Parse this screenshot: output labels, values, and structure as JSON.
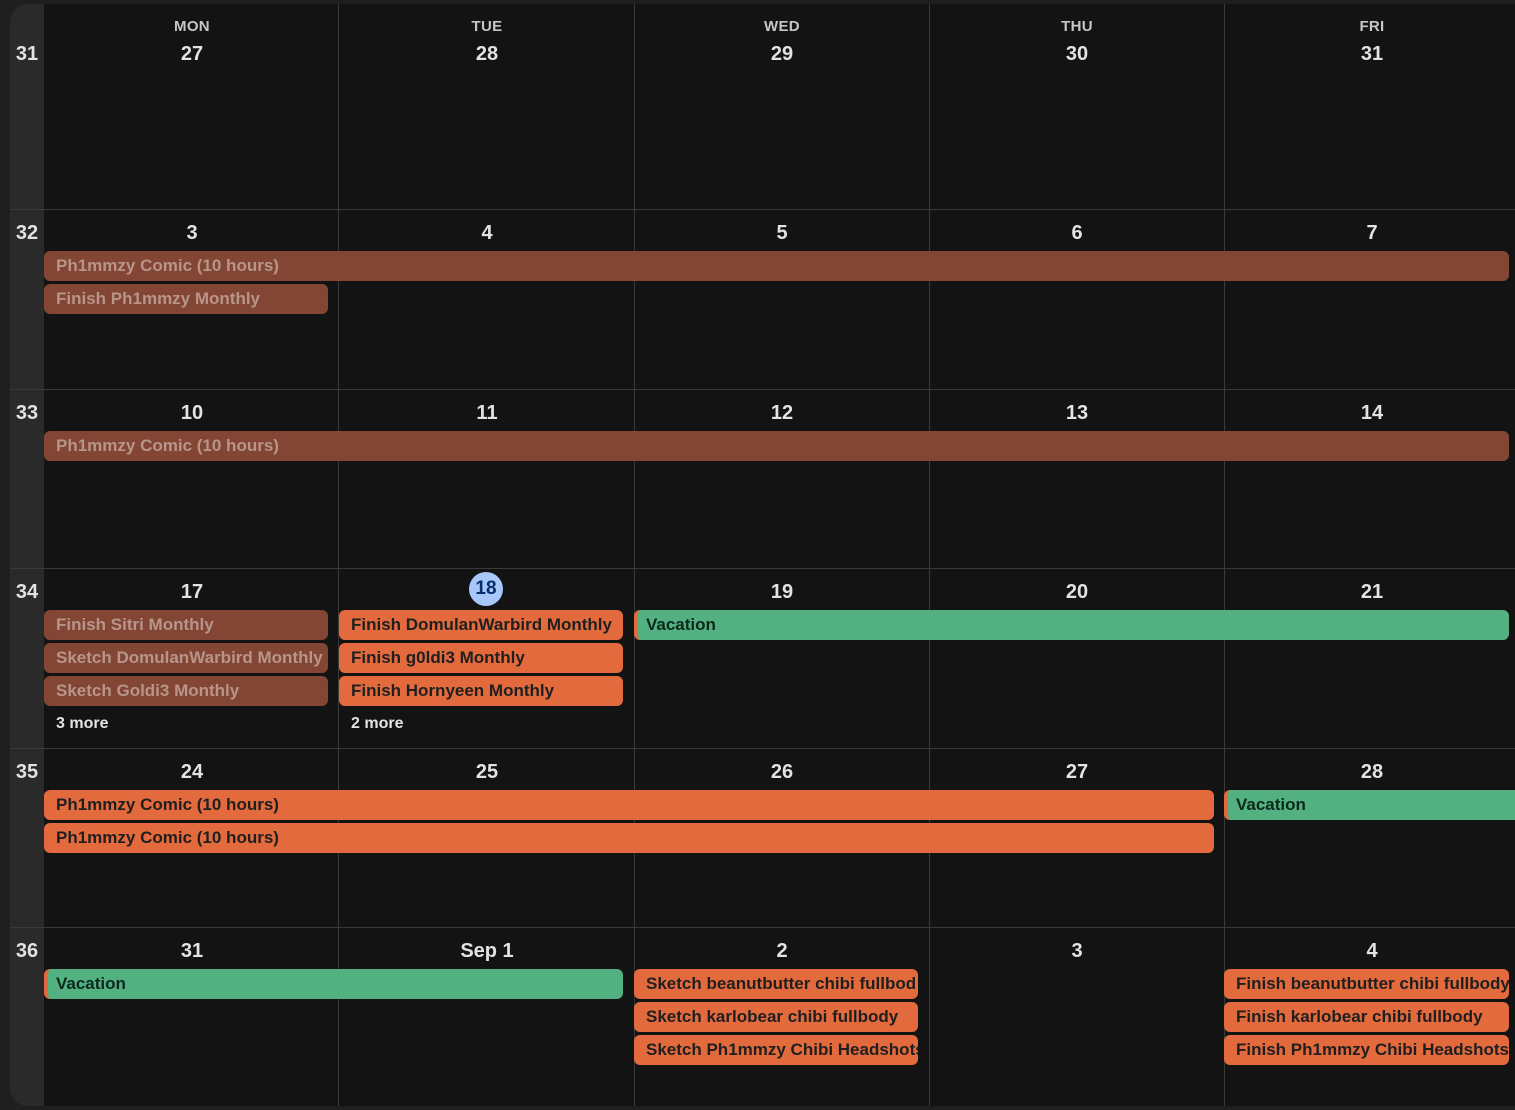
{
  "weekdays": [
    "MON",
    "TUE",
    "WED",
    "THU",
    "FRI"
  ],
  "weeks": [
    {
      "number": "31",
      "days": [
        "27",
        "28",
        "29",
        "30",
        "31"
      ]
    },
    {
      "number": "32",
      "days": [
        "3",
        "4",
        "5",
        "6",
        "7"
      ]
    },
    {
      "number": "33",
      "days": [
        "10",
        "11",
        "12",
        "13",
        "14"
      ]
    },
    {
      "number": "34",
      "days": [
        "17",
        "18",
        "19",
        "20",
        "21"
      ]
    },
    {
      "number": "35",
      "days": [
        "24",
        "25",
        "26",
        "27",
        "28"
      ]
    },
    {
      "number": "36",
      "days": [
        "31",
        "Sep 1",
        "2",
        "3",
        "4"
      ]
    }
  ],
  "today": "18",
  "events": {
    "w32_comic": "Ph1mmzy Comic (10 hours)",
    "w32_monthly": "Finish Ph1mmzy Monthly",
    "w33_comic": "Ph1mmzy Comic (10 hours)",
    "w34_sitri": "Finish Sitri Monthly",
    "w34_sketch_domulan": "Sketch DomulanWarbird Monthly",
    "w34_sketch_goldi": "Sketch Goldi3 Monthly",
    "w34_mon_more": "3 more",
    "w34_finish_domulan": "Finish DomulanWarbird Monthly",
    "w34_finish_g0ldi3": "Finish g0ldi3 Monthly",
    "w34_finish_hornyeen": "Finish Hornyeen Monthly",
    "w34_tue_more": "2 more",
    "w34_vacation": "Vacation",
    "w35_comic_1": "Ph1mmzy Comic (10 hours)",
    "w35_comic_2": "Ph1mmzy Comic (10 hours)",
    "w35_vacation": "Vacation",
    "w36_vacation": "Vacation",
    "w36_sketch_beanut": "Sketch beanutbutter chibi fullbod",
    "w36_sketch_karlo": "Sketch karlobear chibi fullbody",
    "w36_sketch_headshots": "Sketch Ph1mmzy Chibi Headshots",
    "w36_finish_beanut": "Finish beanutbutter chibi fullbody",
    "w36_finish_karlo": "Finish karlobear chibi fullbody",
    "w36_finish_headshots": "Finish Ph1mmzy Chibi Headshots :"
  },
  "colors": {
    "past_event": "#834634",
    "event_orange": "#e36a3c",
    "event_green": "#52b081",
    "today_highlight": "#a8c7fa"
  }
}
